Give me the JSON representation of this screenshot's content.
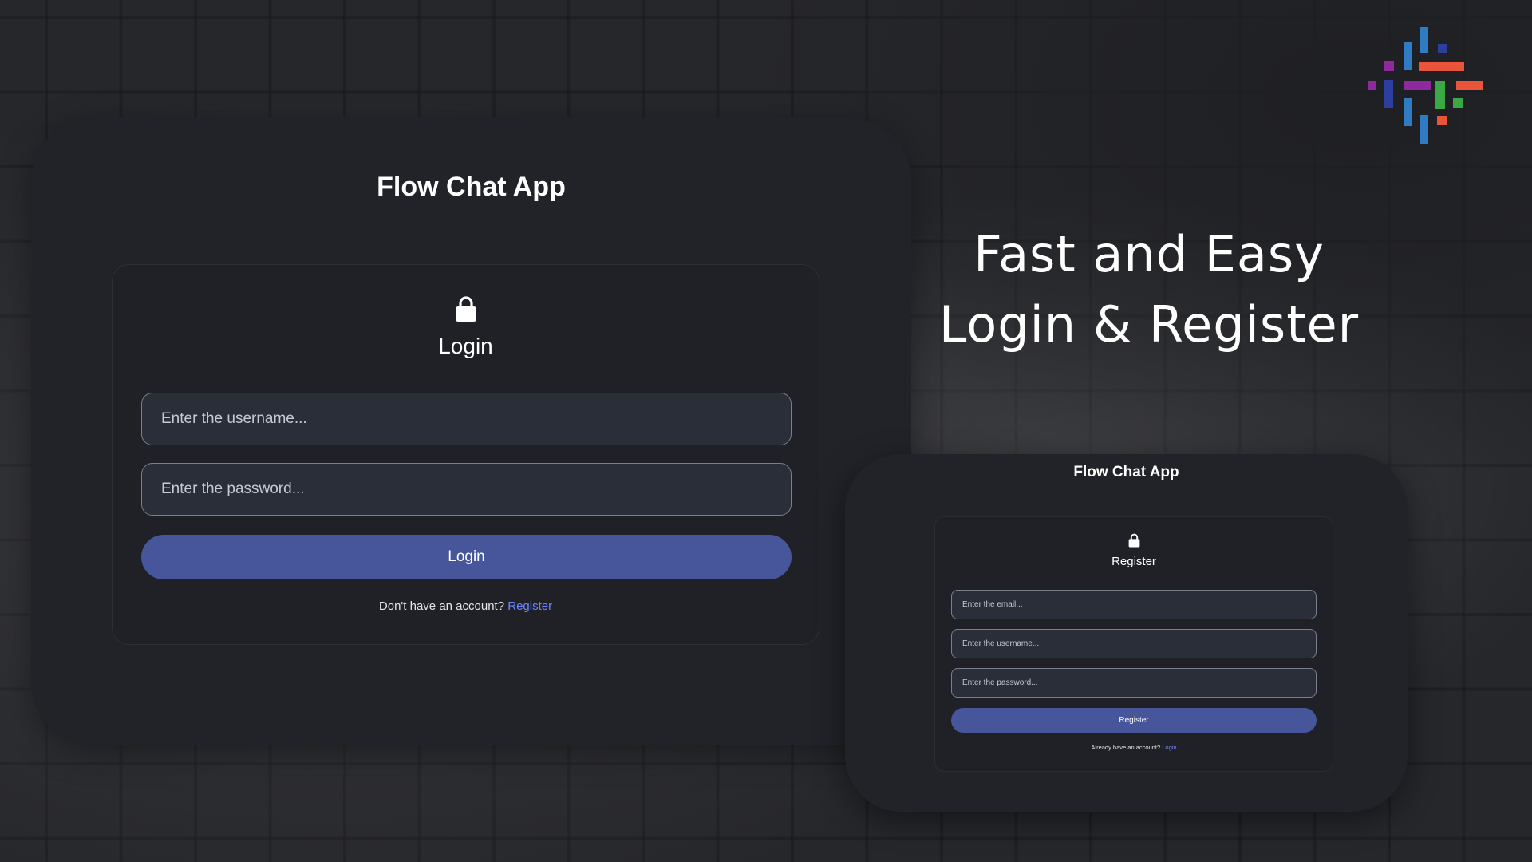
{
  "headline": {
    "line1": "Fast and Easy",
    "line2": "Login & Register"
  },
  "login_card": {
    "app_title": "Flow Chat App",
    "form_title": "Login",
    "username_placeholder": "Enter the username...",
    "password_placeholder": "Enter the password...",
    "submit_label": "Login",
    "switch_prompt": "Don't have an account?",
    "switch_link": "Register"
  },
  "register_card": {
    "app_title": "Flow Chat App",
    "form_title": "Register",
    "email_placeholder": "Enter the email...",
    "username_placeholder": "Enter the username...",
    "password_placeholder": "Enter the password...",
    "submit_label": "Register",
    "switch_prompt": "Already have an account?",
    "switch_link": "Login"
  },
  "icons": {
    "lock": "lock-icon",
    "logo": "brand-logo"
  },
  "colors": {
    "button": "#47569a",
    "link": "#6a86ff",
    "card": "#212329",
    "logo_blue": "#2f7bc4",
    "logo_navy": "#2c3e9e",
    "logo_purple": "#8e2a9e",
    "logo_orange": "#e8553a",
    "logo_green": "#3aa845"
  }
}
